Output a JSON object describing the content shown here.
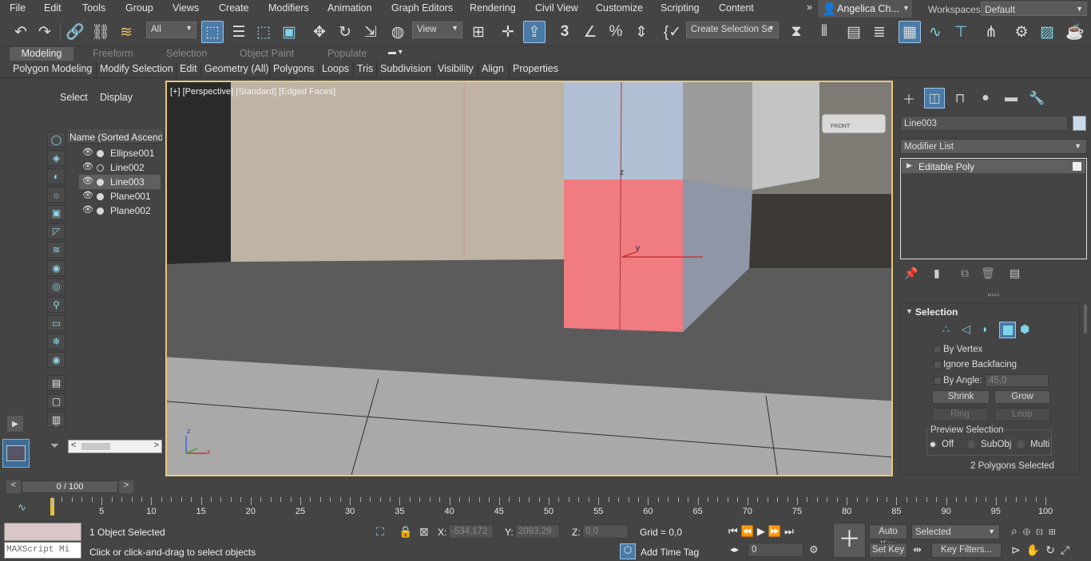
{
  "menu": {
    "items": [
      "File",
      "Edit",
      "Tools",
      "Group",
      "Views",
      "Create",
      "Modifiers",
      "Animation",
      "Graph Editors",
      "Rendering",
      "Civil View",
      "Customize",
      "Scripting",
      "Content"
    ],
    "overflow": "»",
    "user": "Angelica Ch...",
    "workspaces_label": "Workspaces:",
    "workspace_value": "Default"
  },
  "toolbar": {
    "selection_filter": "All",
    "ref_coord": "View",
    "named_selection_placeholder": "Create Selection Se",
    "snap_number": "3",
    "angle_snap": "∠",
    "percent_snap": "%"
  },
  "ribbon": {
    "tabs": [
      "Modeling",
      "Freeform",
      "Selection",
      "Object Paint",
      "Populate"
    ],
    "active_tab": "Modeling",
    "bar": [
      "Polygon Modeling",
      "Modify Selection",
      "Edit",
      "Geometry (All)",
      "Polygons",
      "Loops",
      "Tris",
      "Subdivision",
      "Visibility",
      "Align",
      "Properties"
    ]
  },
  "scene_explorer": {
    "tabs": [
      "Select",
      "Display"
    ],
    "column_header": "Name (Sorted Ascending)",
    "rows": [
      {
        "name": "Ellipse001",
        "selected": false
      },
      {
        "name": "Line002",
        "selected": false
      },
      {
        "name": "Line003",
        "selected": true
      },
      {
        "name": "Plane001",
        "selected": false
      },
      {
        "name": "Plane002",
        "selected": false
      }
    ]
  },
  "viewport": {
    "label_plus": "[+]",
    "label_view": "[Perspective]",
    "label_shading": "[Standard]",
    "label_edges": "[Edged Faces]",
    "gizmo_z": "z",
    "gizmo_y": "y",
    "axis_z": "z",
    "axis_x": "x",
    "view_cube": "FRONT"
  },
  "command_panel": {
    "object_name": "Line003",
    "object_color": "#c9d9ee",
    "modifier_list": "Modifier List",
    "stack_item": "Editable Poly",
    "rollout_title": "Selection",
    "by_vertex": "By Vertex",
    "ignore_backfacing": "Ignore Backfacing",
    "by_angle": "By Angle:",
    "angle_value": "45,0",
    "shrink": "Shrink",
    "grow": "Grow",
    "ring": "Ring",
    "loop": "Loop",
    "preview_title": "Preview Selection",
    "preview_off": "Off",
    "preview_subobj": "SubObj",
    "preview_multi": "Multi",
    "status": "2 Polygons Selected"
  },
  "timeline": {
    "frame_display": "0 / 100",
    "prev": "<",
    "next": ">",
    "ticks": [
      5,
      10,
      15,
      20,
      25,
      30,
      35,
      40,
      45,
      50,
      55,
      60,
      65,
      70,
      75,
      80,
      85,
      90,
      95,
      100
    ]
  },
  "status": {
    "maxscript_placeholder": "MAXScript Mi",
    "objects_selected": "1 Object Selected",
    "prompt": "Click or click-and-drag to select objects",
    "x_label": "X:",
    "x_value": "-534,172",
    "y_label": "Y:",
    "y_value": "2093,29",
    "z_label": "Z:",
    "z_value": "0,0",
    "grid": "Grid = 0,0",
    "add_time_tag": "Add Time Tag",
    "auto_key": "Auto Key",
    "selected_dropdown": "Selected",
    "set_key": "Set Key",
    "key_filters": "Key Filters...",
    "frame_value": "0"
  }
}
